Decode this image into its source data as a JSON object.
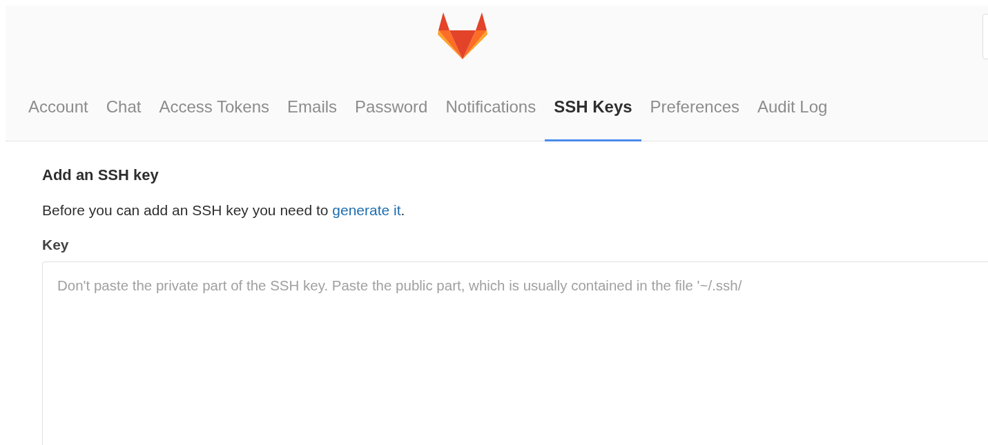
{
  "tabs": [
    {
      "label": "Account",
      "selected": false
    },
    {
      "label": "Chat",
      "selected": false
    },
    {
      "label": "Access Tokens",
      "selected": false
    },
    {
      "label": "Emails",
      "selected": false
    },
    {
      "label": "Password",
      "selected": false
    },
    {
      "label": "Notifications",
      "selected": false
    },
    {
      "label": "SSH Keys",
      "selected": true
    },
    {
      "label": "Preferences",
      "selected": false
    },
    {
      "label": "Audit Log",
      "selected": false
    }
  ],
  "section": {
    "title": "Add an SSH key",
    "intro": "Before you can add an SSH key you need to ",
    "link": "generate it",
    "after_link": "."
  },
  "key_field": {
    "label": "Key",
    "placeholder": "Don't paste the private part of the SSH key. Paste the public part, which is usually contained in the file '~/.ssh/"
  }
}
